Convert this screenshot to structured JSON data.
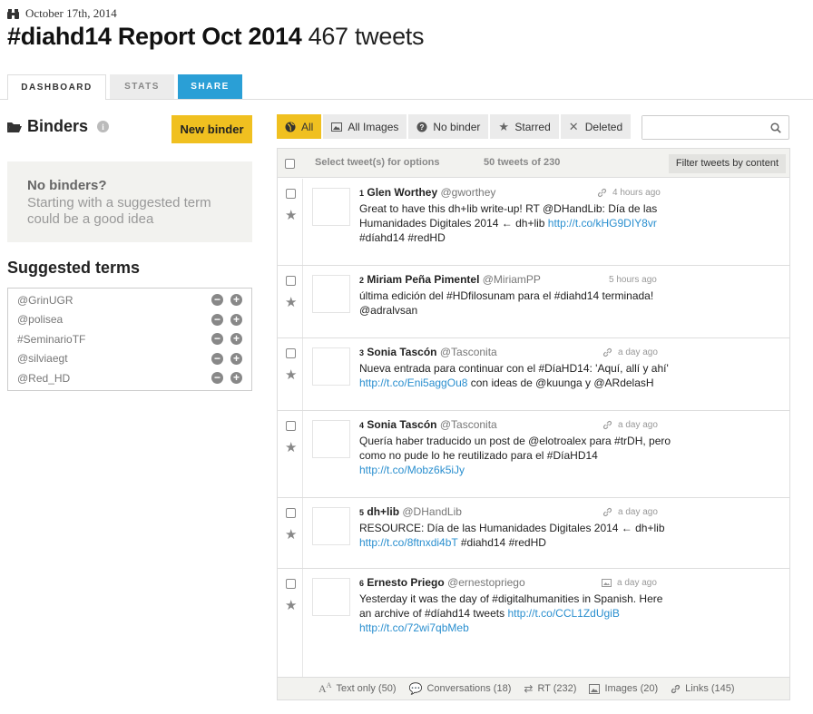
{
  "header": {
    "date": "October 17th, 2014",
    "title": "#diahd14 Report Oct 2014",
    "count": "467 tweets"
  },
  "tabs": [
    "DASHBOARD",
    "STATS",
    "SHARE"
  ],
  "sidebar": {
    "binders_title": "Binders",
    "new_binder": "New binder",
    "no_binders_heading": "No binders?",
    "no_binders_text": "Starting with a suggested term could be a good idea",
    "suggested_title": "Suggested terms",
    "terms": [
      "@GrinUGR",
      "@polisea",
      "#SeminarioTF",
      "@silviaegt",
      "@Red_HD"
    ]
  },
  "filters": {
    "buttons": [
      "All",
      "All Images",
      "No binder",
      "Starred",
      "Deleted"
    ],
    "active": "All",
    "search_placeholder": ""
  },
  "panel": {
    "select_label": "Select tweet(s) for options",
    "count_label": "50 tweets of 230",
    "filter_button": "Filter tweets by content"
  },
  "tweets": [
    {
      "num": "1",
      "name": "Glen Worthey",
      "handle": "@gworthey",
      "time": "4 hours ago",
      "meta_icon": "link-icon",
      "body": [
        "Great to have this dh+lib write-up! RT @DHandLib: Día de las",
        "Humanidades Digitales 2014 ← dh+lib ",
        "http://t.co/kHG9DIY8vr",
        "#díahd14 #redHD"
      ]
    },
    {
      "num": "2",
      "name": "Miriam Peña Pimentel",
      "handle": "@MiriamPP",
      "time": "5 hours ago",
      "meta_icon": "",
      "body": [
        "última edición del #HDfilosunam para el #diahd14 terminada!",
        "@adralvsan"
      ]
    },
    {
      "num": "3",
      "name": "Sonia Tascón",
      "handle": "@Tasconita",
      "time": "a day ago",
      "meta_icon": "link-icon",
      "body": [
        "Nueva entrada para continuar con el #DíaHD14: 'Aquí, allí y ahí'",
        "http://t.co/Eni5aggOu8",
        " con ideas de @kuunga y @ARdelasH"
      ]
    },
    {
      "num": "4",
      "name": "Sonia Tascón",
      "handle": "@Tasconita",
      "time": "a day ago",
      "meta_icon": "link-icon",
      "body": [
        "Quería haber traducido un post de @elotroalex para #trDH, pero",
        "como no pude lo he reutilizado para el #DíaHD14",
        "http://t.co/Mobz6k5iJy"
      ]
    },
    {
      "num": "5",
      "name": "dh+lib",
      "handle": "@DHandLib",
      "time": "a day ago",
      "meta_icon": "link-icon",
      "body": [
        "RESOURCE: Día de las Humanidades Digitales 2014 ← dh+lib",
        "http://t.co/8ftnxdi4bT",
        " #diahd14 #redHD"
      ]
    },
    {
      "num": "6",
      "name": "Ernesto Priego",
      "handle": "@ernestopriego",
      "time": "a day ago",
      "meta_icon": "image-icon",
      "body": [
        "Yesterday it was the day of #digitalhumanities in Spanish. Here",
        "an archive of #díahd14 tweets ",
        "http://t.co/CCL1ZdUgiB",
        "http://t.co/72wi7qbMeb"
      ]
    }
  ],
  "footer": {
    "items": [
      "Text only (50)",
      "Conversations (18)",
      "RT (232)",
      "Images (20)",
      "Links (145)"
    ]
  }
}
